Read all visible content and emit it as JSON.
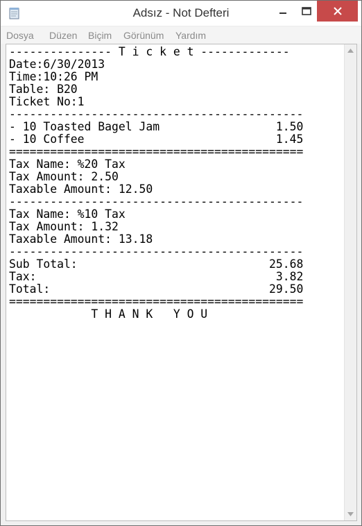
{
  "window": {
    "title": "Adsız - Not Defteri"
  },
  "menu": {
    "items": [
      "Dosya",
      "Düzen",
      "Biçim",
      "Görünüm",
      "Yardım"
    ]
  },
  "document": {
    "lines": [
      "--------------- T i c k e t -------------",
      "Date:6/30/2013",
      "Time:10:26 PM",
      "Table: B20",
      "Ticket No:1",
      "-------------------------------------------",
      "- 10 Toasted Bagel Jam                 1.50",
      "- 10 Coffee                            1.45",
      "===========================================",
      "Tax Name: %20 Tax",
      "Tax Amount: 2.50",
      "Taxable Amount: 12.50",
      "-------------------------------------------",
      "Tax Name: %10 Tax",
      "Tax Amount: 1.32",
      "Taxable Amount: 13.18",
      "-------------------------------------------",
      "Sub Total:                            25.68",
      "Tax:                                   3.82",
      "Total:                                29.50",
      "===========================================",
      "            T H A N K   Y O U"
    ]
  }
}
